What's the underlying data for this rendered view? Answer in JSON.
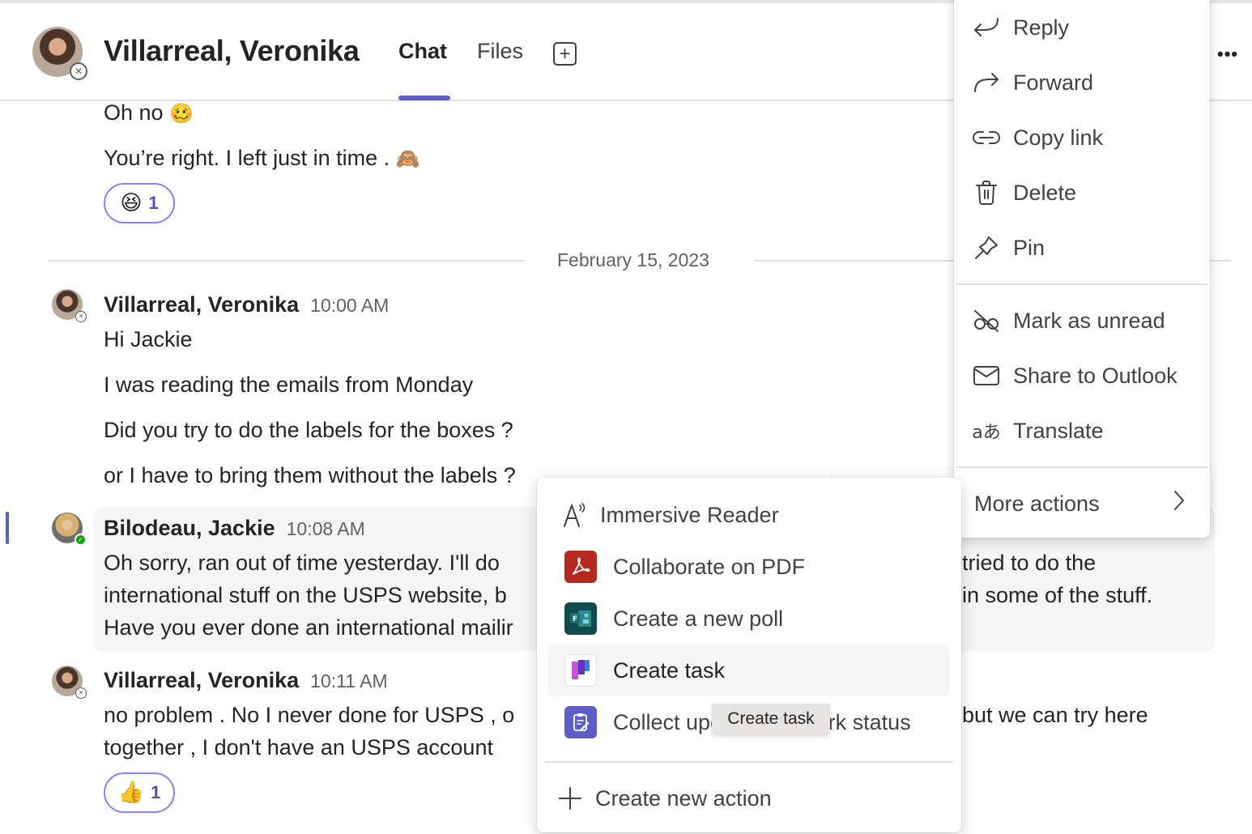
{
  "header": {
    "title": "Villarreal, Veronika",
    "tabs": [
      {
        "label": "Chat",
        "active": true
      },
      {
        "label": "Files",
        "active": false
      }
    ],
    "add_tab_icon": "plus-square-icon",
    "more_icon": "ellipsis-icon",
    "more_label": "•••",
    "presence": "offline"
  },
  "messages": {
    "earlier": [
      {
        "text": "Oh no",
        "emoji": "🥴"
      },
      {
        "text": "You’re right. I left just in time .",
        "emoji": "🙈"
      }
    ],
    "earlier_reaction": {
      "emoji": "😆",
      "count": "1"
    },
    "date_divider": "February 15, 2023",
    "groups": [
      {
        "author": "Villarreal, Veronika",
        "time": "10:00 AM",
        "presence": "offline",
        "lines": [
          "Hi Jackie",
          "I was reading the emails from Monday",
          "Did you try to do the labels for the boxes ?",
          "or I have to bring them without the labels ?"
        ]
      },
      {
        "author": "Bilodeau, Jackie",
        "time": "10:08 AM",
        "presence": "available",
        "lines_left": [
          "Oh sorry, ran out of time yesterday. I'll do",
          "international stuff on the USPS website, b",
          "Have you ever done an international mailir"
        ],
        "lines_right": [
          "tried to do the",
          "in some of the stuff."
        ]
      },
      {
        "author": "Villarreal, Veronika",
        "time": "10:11 AM",
        "presence": "offline",
        "lines_left": [
          "no problem . No I never done for USPS , o",
          "together , I don't have an USPS account"
        ],
        "lines_right": [
          "but we can try here"
        ],
        "reaction": {
          "emoji": "👍",
          "count": "1"
        }
      }
    ]
  },
  "context_menu": {
    "items": [
      {
        "label": "Reply",
        "icon": "reply-icon"
      },
      {
        "label": "Forward",
        "icon": "forward-icon"
      },
      {
        "label": "Copy link",
        "icon": "link-icon"
      },
      {
        "label": "Delete",
        "icon": "trash-icon"
      },
      {
        "label": "Pin",
        "icon": "pin-icon"
      },
      {
        "label": "Mark as unread",
        "icon": "mark-unread-icon"
      },
      {
        "label": "Share to Outlook",
        "icon": "mail-icon"
      },
      {
        "label": "Translate",
        "icon": "translate-icon"
      },
      {
        "label": "More actions",
        "icon": "chevron-right-icon"
      }
    ]
  },
  "more_actions_menu": {
    "items": [
      {
        "label": "Immersive Reader",
        "icon": "immersive-reader-icon"
      },
      {
        "label": "Collaborate on PDF",
        "icon": "adobe-acrobat-icon",
        "color": "#b4281e"
      },
      {
        "label": "Create a new poll",
        "icon": "forms-icon",
        "color": "#0f4a4c"
      },
      {
        "label": "Create task",
        "icon": "planner-icon",
        "hovered": true
      },
      {
        "label": "Collect updates on work status",
        "icon": "updates-icon",
        "color": "#5b5fc7"
      },
      {
        "label": "Create new action",
        "icon": "plus-icon"
      }
    ],
    "tooltip": "Create task"
  },
  "colors": {
    "accent": "#5b5fc7",
    "reaction_border": "#7f85f5",
    "presence_available": "#13a10e"
  }
}
